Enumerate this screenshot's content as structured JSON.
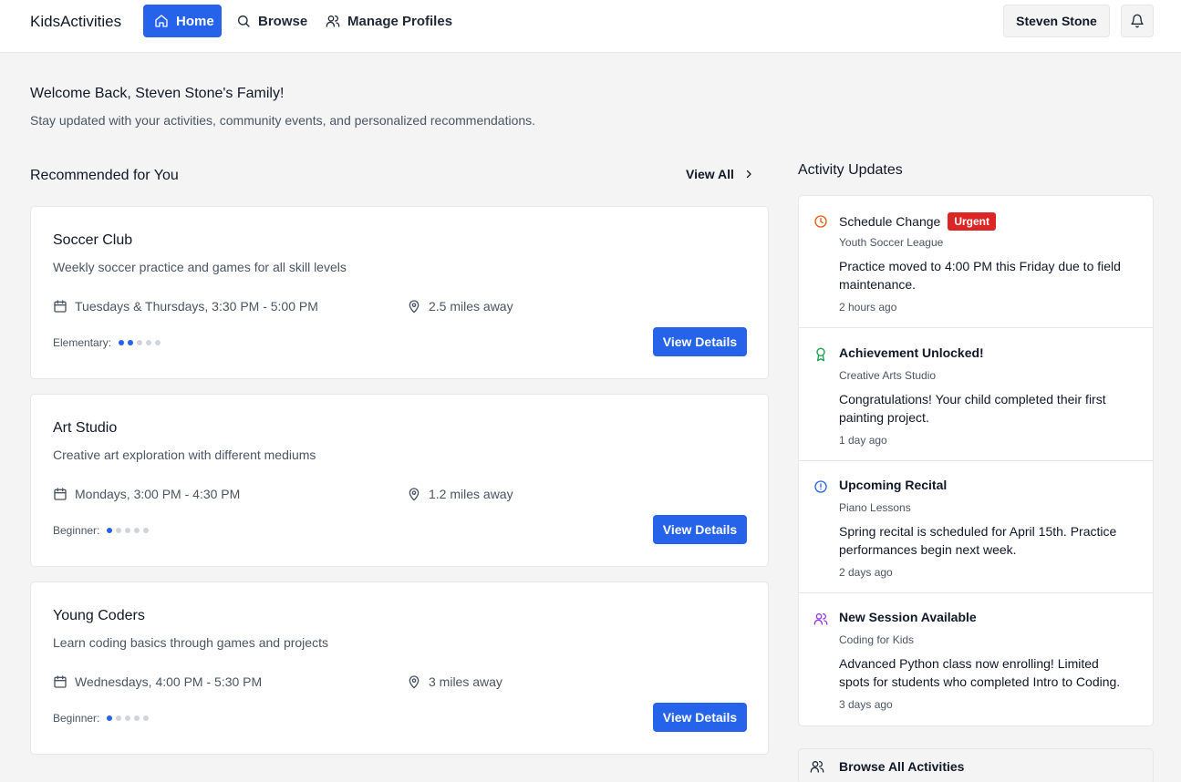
{
  "brand": "KidsActivities",
  "nav": {
    "home": "Home",
    "browse": "Browse",
    "profiles": "Manage Profiles"
  },
  "user": "Steven Stone",
  "welcome": {
    "title": "Welcome Back, Steven Stone's Family!",
    "subtitle": "Stay updated with your activities, community events, and personalized recommendations."
  },
  "recommended": {
    "title": "Recommended for You",
    "view_all": "View All",
    "details_label": "View Details",
    "cards": [
      {
        "title": "Soccer Club",
        "desc": "Weekly soccer practice and games for all skill levels",
        "schedule": "Tuesdays & Thursdays, 3:30 PM - 5:00 PM",
        "distance": "2.5 miles away",
        "level": "Elementary:",
        "level_value": 2,
        "level_max": 5
      },
      {
        "title": "Art Studio",
        "desc": "Creative art exploration with different mediums",
        "schedule": "Mondays, 3:00 PM - 4:30 PM",
        "distance": "1.2 miles away",
        "level": "Beginner:",
        "level_value": 1,
        "level_max": 5
      },
      {
        "title": "Young Coders",
        "desc": "Learn coding basics through games and projects",
        "schedule": "Wednesdays, 4:00 PM - 5:30 PM",
        "distance": "3 miles away",
        "level": "Beginner:",
        "level_value": 1,
        "level_max": 5
      }
    ]
  },
  "updates": {
    "title": "Activity Updates",
    "items": [
      {
        "title": "Schedule Change",
        "badge": "Urgent",
        "org": "Youth Soccer League",
        "message": "Practice moved to 4:00 PM this Friday due to field maintenance.",
        "time": "2 hours ago",
        "icon": "clock-icon",
        "color": "#ea580c"
      },
      {
        "title": "Achievement Unlocked!",
        "org": "Creative Arts Studio",
        "message": "Congratulations! Your child completed their first painting project.",
        "time": "1 day ago",
        "icon": "award-icon",
        "color": "#16a34a"
      },
      {
        "title": "Upcoming Recital",
        "org": "Piano Lessons",
        "message": "Spring recital is scheduled for April 15th. Practice performances begin next week.",
        "time": "2 days ago",
        "icon": "alert-circle-icon",
        "color": "#2563eb"
      },
      {
        "title": "New Session Available",
        "org": "Coding for Kids",
        "message": "Advanced Python class now enrolling! Limited spots for students who completed Intro to Coding.",
        "time": "3 days ago",
        "icon": "users-icon",
        "color": "#9333ea"
      }
    ]
  },
  "browse_all": "Browse All Activities",
  "colors": {
    "primary": "#2563eb",
    "urgent": "#dc2626",
    "background": "#f4f4f5"
  }
}
